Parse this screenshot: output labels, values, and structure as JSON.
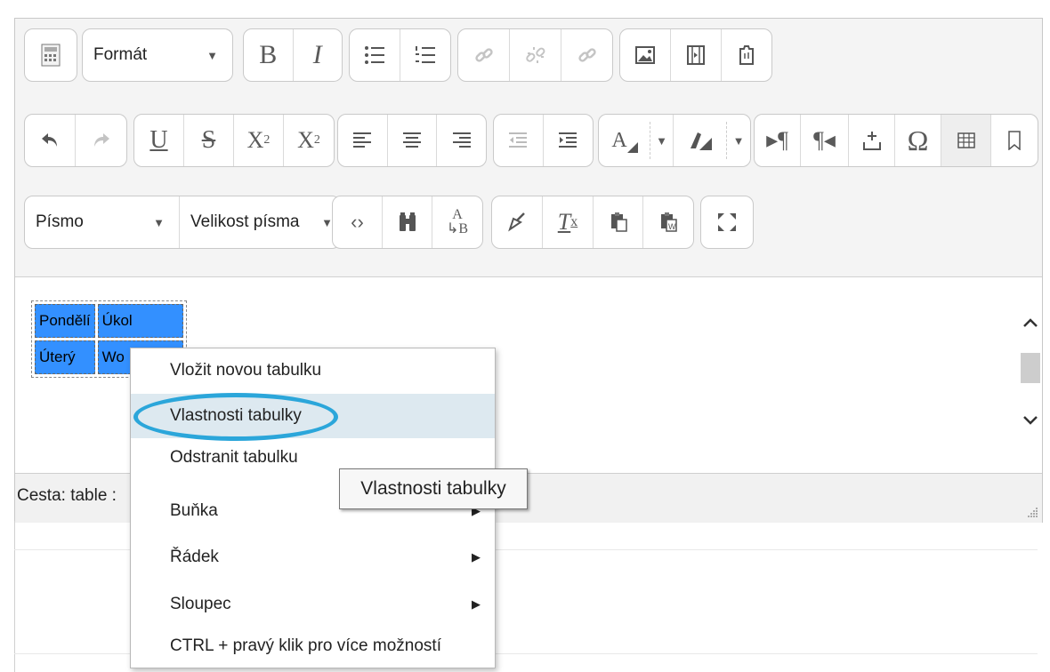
{
  "toolbar": {
    "format_label": "Formát",
    "font_label": "Písmo",
    "size_label": "Velikost písma",
    "row1": [
      "toolbar-toggle-icon",
      "bold-icon",
      "italic-icon",
      "bullet-list-icon",
      "numbered-list-icon",
      "link-icon",
      "unlink-icon",
      "anchor-icon",
      "image-icon",
      "media-icon",
      "manage-files-icon"
    ],
    "row2": [
      "undo-icon",
      "redo-icon",
      "underline-icon",
      "strikethrough-icon",
      "subscript-icon",
      "superscript-icon",
      "align-left-icon",
      "align-center-icon",
      "align-right-icon",
      "outdent-icon",
      "indent-icon",
      "text-color-icon",
      "background-color-icon",
      "ltr-icon",
      "rtl-icon",
      "equation-icon",
      "special-char-icon",
      "table-icon",
      "bookmark-icon"
    ],
    "row3": [
      "html-icon",
      "find-icon",
      "replace-icon",
      "clear-format-icon",
      "remove-format-icon",
      "paste-text-icon",
      "paste-word-icon",
      "fullscreen-icon"
    ]
  },
  "table": {
    "rows": [
      [
        "Pondělí",
        "Úkol"
      ],
      [
        "Úterý",
        "Wo"
      ]
    ]
  },
  "statusbar": {
    "path_label": "Cesta: table :"
  },
  "context_menu": {
    "items": [
      {
        "label": "Vložit novou tabulku",
        "submenu": false
      },
      {
        "label": "Vlastnosti tabulky",
        "submenu": false,
        "highlighted": true
      },
      {
        "label": "Odstranit tabulku",
        "submenu": false
      },
      {
        "label": "Buňka",
        "submenu": true
      },
      {
        "label": "Řádek",
        "submenu": true
      },
      {
        "label": "Sloupec",
        "submenu": true
      },
      {
        "label": "CTRL + pravý klik pro více možností",
        "submenu": false
      }
    ]
  },
  "tooltip": {
    "text": "Vlastnosti tabulky"
  },
  "colors": {
    "selection": "#3390ff",
    "highlight_ring": "#2ba6da",
    "menu_hover": "#dde9f0"
  }
}
